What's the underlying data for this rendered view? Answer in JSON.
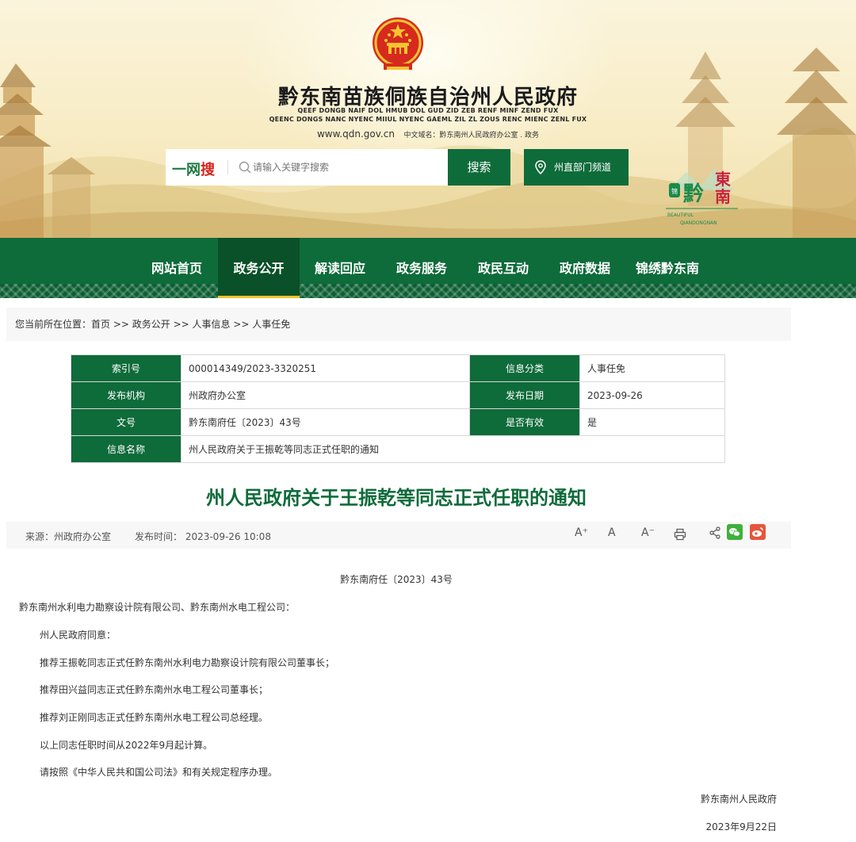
{
  "header": {
    "site_title": "黔东南苗族侗族自治州人民政府",
    "sub_line1": "QEEF DONGB NAIF DOL HMUB DOL GUD ZID ZEB RENF MINF ZEND FUX",
    "sub_line2": "QEENC DONGS NANC NYENC MIIUL NYENC GAEML ZIL ZL ZOUS RENC MIENC ZENL FUX",
    "url": "www.qdn.gov.cn",
    "cn_domain": "中文域名：黔东南州人民政府办公室 . 政务",
    "search_logo_a": "一网",
    "search_logo_b": "搜",
    "search_placeholder": "请输入关键字搜索",
    "search_button": "搜索",
    "dept_button": "州直部门频道",
    "brand_logo_text": "锦绣黔東南",
    "brand_logo_en1": "BEAUTIFUL",
    "brand_logo_en2": "QIANDONGNAN"
  },
  "nav": {
    "items": [
      {
        "label": "网站首页"
      },
      {
        "label": "政务公开",
        "active": true
      },
      {
        "label": "解读回应"
      },
      {
        "label": "政务服务"
      },
      {
        "label": "政民互动"
      },
      {
        "label": "政府数据"
      },
      {
        "label": "锦绣黔东南"
      }
    ]
  },
  "breadcrumb": {
    "prefix": "您当前所在位置：",
    "path": "首页 >> 政务公开 >> 人事信息 >> 人事任免"
  },
  "info": {
    "index_label": "索引号",
    "index_value": "000014349/2023-3320251",
    "category_label": "信息分类",
    "category_value": "人事任免",
    "org_label": "发布机构",
    "org_value": "州政府办公室",
    "date_label": "发布日期",
    "date_value": "2023-09-26",
    "doc_label": "文号",
    "doc_value": "黔东南府任〔2023〕43号",
    "valid_label": "是否有效",
    "valid_value": "是",
    "name_label": "信息名称",
    "name_value": "州人民政府关于王振乾等同志正式任职的通知"
  },
  "article": {
    "title": "州人民政府关于王振乾等同志正式任职的通知",
    "source": "来源：州政府办公室",
    "publish_time": "发布时间：  2023-09-26 10:08",
    "font_large": "A⁺",
    "font_mid": "A",
    "font_small": "A⁻",
    "doc_number": "黔东南府任〔2023〕43号",
    "recipient": "黔东南州水利电力勘察设计院有限公司、黔东南州水电工程公司：",
    "paragraphs": [
      "州人民政府同意：",
      "推荐王振乾同志正式任黔东南州水利电力勘察设计院有限公司董事长；",
      "推荐田兴益同志正式任黔东南州水电工程公司董事长；",
      "推荐刘正刚同志正式任黔东南州水电工程公司总经理。",
      "以上同志任职时间从2022年9月起计算。",
      "请按照《中华人民共和国公司法》和有关规定程序办理。"
    ],
    "signature": "黔东南州人民政府",
    "sign_date": "2023年9月22日"
  }
}
